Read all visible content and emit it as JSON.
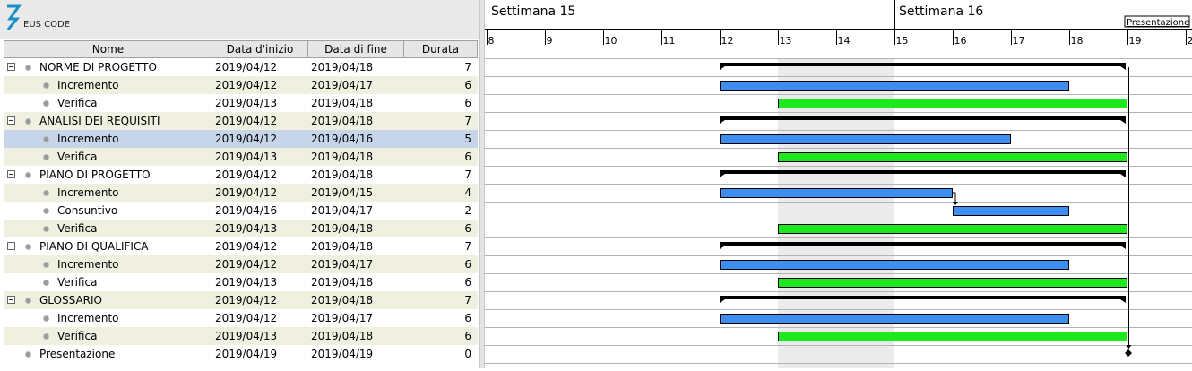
{
  "logo": {
    "text": "EUS CODE"
  },
  "table": {
    "headers": [
      "Nome",
      "Data d'inizio",
      "Data di fine",
      "Durata"
    ],
    "rows": [
      {
        "level": 0,
        "name": "NORME DI PROGETTO",
        "start": "2019/04/12",
        "end": "2019/04/18",
        "duration": "7"
      },
      {
        "level": 1,
        "name": "Incremento",
        "start": "2019/04/12",
        "end": "2019/04/17",
        "duration": "6"
      },
      {
        "level": 1,
        "name": "Verifica",
        "start": "2019/04/13",
        "end": "2019/04/18",
        "duration": "6"
      },
      {
        "level": 0,
        "name": "ANALISI DEI REQUISITI",
        "start": "2019/04/12",
        "end": "2019/04/18",
        "duration": "7"
      },
      {
        "level": 1,
        "name": "Incremento",
        "start": "2019/04/12",
        "end": "2019/04/16",
        "duration": "5",
        "selected": true
      },
      {
        "level": 1,
        "name": "Verifica",
        "start": "2019/04/13",
        "end": "2019/04/18",
        "duration": "6"
      },
      {
        "level": 0,
        "name": "PIANO DI PROGETTO",
        "start": "2019/04/12",
        "end": "2019/04/18",
        "duration": "7"
      },
      {
        "level": 1,
        "name": "Incremento",
        "start": "2019/04/12",
        "end": "2019/04/15",
        "duration": "4"
      },
      {
        "level": 1,
        "name": "Consuntivo",
        "start": "2019/04/16",
        "end": "2019/04/17",
        "duration": "2"
      },
      {
        "level": 1,
        "name": "Verifica",
        "start": "2019/04/13",
        "end": "2019/04/18",
        "duration": "6"
      },
      {
        "level": 0,
        "name": "PIANO DI QUALIFICA",
        "start": "2019/04/12",
        "end": "2019/04/18",
        "duration": "7"
      },
      {
        "level": 1,
        "name": "Incremento",
        "start": "2019/04/12",
        "end": "2019/04/17",
        "duration": "6"
      },
      {
        "level": 1,
        "name": "Verifica",
        "start": "2019/04/13",
        "end": "2019/04/18",
        "duration": "6"
      },
      {
        "level": 0,
        "name": "GLOSSARIO",
        "start": "2019/04/12",
        "end": "2019/04/18",
        "duration": "7"
      },
      {
        "level": 1,
        "name": "Incremento",
        "start": "2019/04/12",
        "end": "2019/04/17",
        "duration": "6"
      },
      {
        "level": 1,
        "name": "Verifica",
        "start": "2019/04/13",
        "end": "2019/04/18",
        "duration": "6"
      },
      {
        "level": -1,
        "name": "Presentazione",
        "start": "2019/04/19",
        "end": "2019/04/19",
        "duration": "0"
      }
    ]
  },
  "gantt": {
    "weeks": [
      {
        "label": "Settimana  15",
        "from_day": 8
      },
      {
        "label": "Settimana  16",
        "from_day": 15
      }
    ],
    "days": [
      "8",
      "9",
      "10",
      "11",
      "12",
      "13",
      "14",
      "15",
      "16",
      "17",
      "18",
      "19",
      "2"
    ],
    "weekend_days": [
      13,
      14
    ],
    "milestone_label": "Presentazione",
    "milestone_day": 19,
    "colors": {
      "summary": "#000000",
      "incremento": "#3c8ef0",
      "verifica": "#1ee81e",
      "weekend": "#ebebeb"
    },
    "bars": [
      {
        "row": 0,
        "kind": "summary",
        "start": 12,
        "end": 19
      },
      {
        "row": 1,
        "kind": "incremento",
        "start": 12,
        "end": 18
      },
      {
        "row": 2,
        "kind": "verifica",
        "start": 13,
        "end": 19
      },
      {
        "row": 3,
        "kind": "summary",
        "start": 12,
        "end": 19
      },
      {
        "row": 4,
        "kind": "incremento",
        "start": 12,
        "end": 17
      },
      {
        "row": 5,
        "kind": "verifica",
        "start": 13,
        "end": 19
      },
      {
        "row": 6,
        "kind": "summary",
        "start": 12,
        "end": 19
      },
      {
        "row": 7,
        "kind": "incremento",
        "start": 12,
        "end": 16
      },
      {
        "row": 8,
        "kind": "incremento",
        "start": 16,
        "end": 18
      },
      {
        "row": 9,
        "kind": "verifica",
        "start": 13,
        "end": 19
      },
      {
        "row": 10,
        "kind": "summary",
        "start": 12,
        "end": 19
      },
      {
        "row": 11,
        "kind": "incremento",
        "start": 12,
        "end": 18
      },
      {
        "row": 12,
        "kind": "verifica",
        "start": 13,
        "end": 19
      },
      {
        "row": 13,
        "kind": "summary",
        "start": 12,
        "end": 19
      },
      {
        "row": 14,
        "kind": "incremento",
        "start": 12,
        "end": 18
      },
      {
        "row": 15,
        "kind": "verifica",
        "start": 13,
        "end": 19
      },
      {
        "row": 16,
        "kind": "milestone",
        "start": 19,
        "end": 19
      }
    ]
  }
}
